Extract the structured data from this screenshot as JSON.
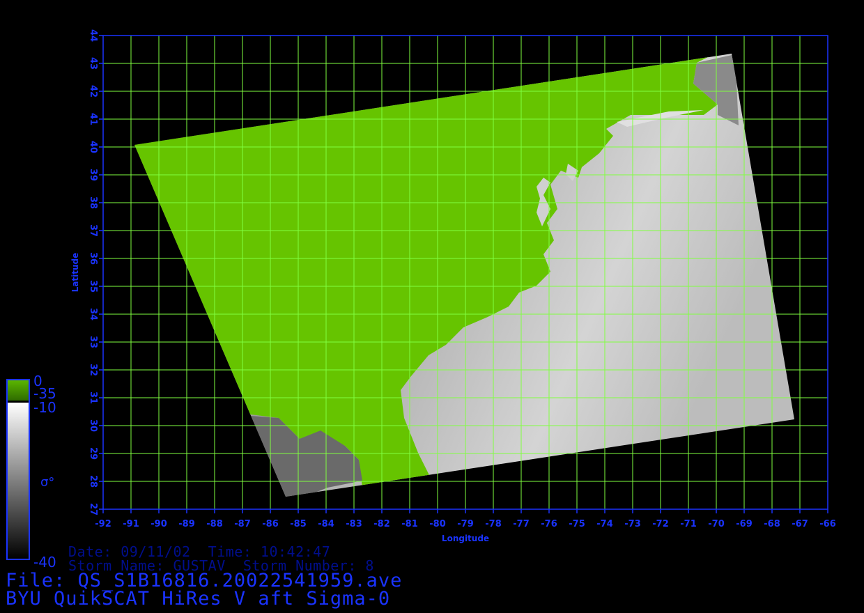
{
  "map": {
    "lon_ticks": [
      "-92",
      "-91",
      "-90",
      "-89",
      "-88",
      "-87",
      "-86",
      "-85",
      "-84",
      "-83",
      "-82",
      "-81",
      "-80",
      "-79",
      "-78",
      "-77",
      "-76",
      "-75",
      "-74",
      "-73",
      "-72",
      "-71",
      "-70",
      "-69",
      "-68",
      "-67",
      "-66"
    ],
    "lat_ticks": [
      "27",
      "28",
      "29",
      "30",
      "31",
      "32",
      "33",
      "34",
      "35",
      "36",
      "37",
      "38",
      "39",
      "40",
      "41",
      "42",
      "43",
      "44"
    ],
    "xlabel": "Longitude",
    "ylabel": "Latitude",
    "lon_range": [
      -92,
      -66
    ],
    "lat_range": [
      27,
      44
    ]
  },
  "colorbar": {
    "land_top": "0",
    "land_bottom": "-35",
    "ocean_top": "-10",
    "ocean_bottom": "-40",
    "symbol": "σ°"
  },
  "info": {
    "date_line": "Date: 09/11/02  Time: 10:42:47",
    "storm_line": "Storm Name: GUSTAV  Storm Number: 8",
    "file_line": "File: QS_S1B16816.20022541959.ave",
    "product_line": "BYU QuikSCAT HiRes V aft Sigma-0"
  },
  "colors": {
    "land": "#66c400",
    "grid": "#80ff40",
    "frame": "#1a33ff",
    "text_dim": "#000e8c"
  }
}
